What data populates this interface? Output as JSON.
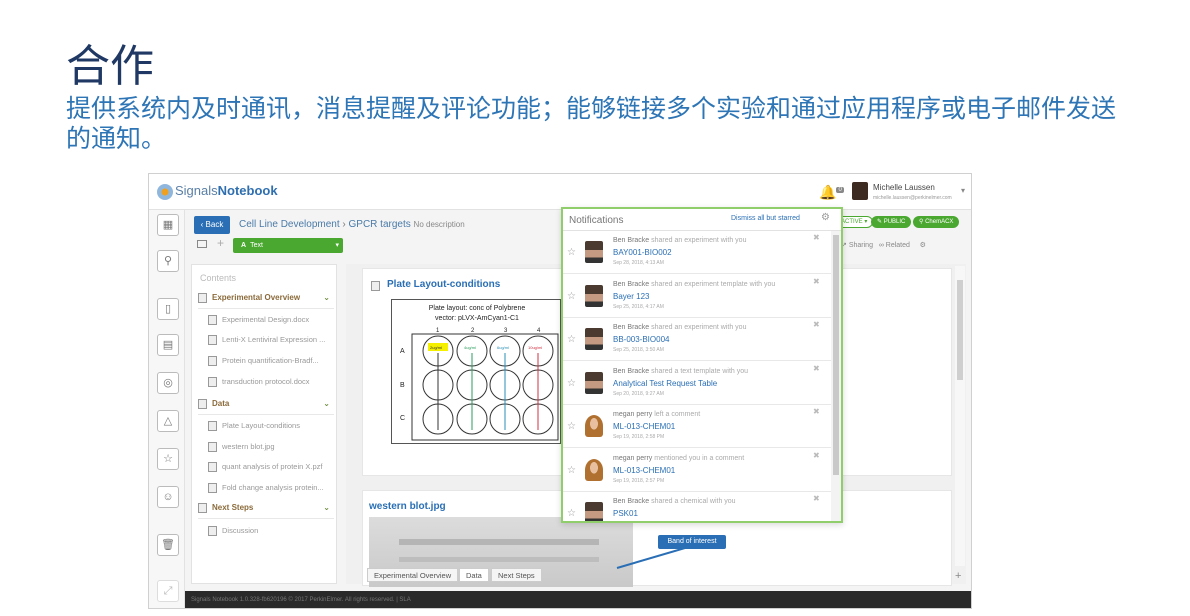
{
  "slide": {
    "title": "合作",
    "subtitle": "提供系统内及时通讯，消息提醒及评论功能；能够链接多个实验和通过应用程序或电子邮件发送的通知。"
  },
  "app": {
    "logo_prefix": "Signals",
    "logo_suffix": "Notebook",
    "bell_count": "0",
    "user_name": "Michelle Laussen",
    "user_email": "michelle.laussen@perkinelmer.com",
    "back_label": "Back",
    "breadcrumb_parent": "Cell Line Development",
    "breadcrumb_current": "GPCR targets",
    "breadcrumb_desc": "No description",
    "text_button": "Text",
    "status_pill": "ACTIVE",
    "public_pill": "PUBLIC",
    "chem_pill": "ChemACX",
    "sharing_label": "Sharing",
    "related_label": "Related",
    "footer_text": "Signals Notebook 1.0.328-fb620196 © 2017 PerkinElmer. All rights reserved. | SLA"
  },
  "contents": {
    "title": "Contents",
    "sections": [
      {
        "label": "Experimental Overview",
        "items": [
          "Experimental Design.docx",
          "Lenti-X Lentiviral Expression ...",
          "Protein quantification-Bradf...",
          "transduction protocol.docx"
        ]
      },
      {
        "label": "Data",
        "items": [
          "Plate Layout-conditions",
          "western blot.jpg",
          "quant analysis of protein X.pzf",
          "Fold change analysis protein..."
        ]
      },
      {
        "label": "Next Steps",
        "items": [
          "Discussion"
        ]
      }
    ]
  },
  "canvas": {
    "card1_title": "Plate Layout-conditions",
    "plate_caption_1": "Plate layout: conc of Polybrene",
    "plate_caption_2": "vector: pLVX-AmCyan1-C1",
    "plate_cols": [
      "1",
      "2",
      "3",
      "4"
    ],
    "plate_rows": [
      "A",
      "B",
      "C"
    ],
    "plate_well_labels": [
      "2ug/ml",
      "4ug/ml",
      "6ug/ml",
      "10ug/ml"
    ],
    "card2_title": "western blot.jpg",
    "band_label": "Band of interest"
  },
  "bottom_tabs": [
    "Experimental Overview",
    "Data",
    "Next Steps"
  ],
  "notifications": {
    "title": "Notifications",
    "dismiss_label": "Dismiss all but starred",
    "items": [
      {
        "who": "Ben Bracke",
        "action": "shared an experiment with you",
        "target": "BAY001-BIO002",
        "date": "Sep 28, 2018, 4:13 AM",
        "avatar": "man"
      },
      {
        "who": "Ben Bracke",
        "action": "shared an experiment template with you",
        "target": "Bayer 123",
        "date": "Sep 25, 2018, 4:17 AM",
        "avatar": "man"
      },
      {
        "who": "Ben Bracke",
        "action": "shared an experiment with you",
        "target": "BB-003-BIO004",
        "date": "Sep 25, 2018, 3:50 AM",
        "avatar": "man"
      },
      {
        "who": "Ben Bracke",
        "action": "shared a text template with you",
        "target": "Analytical Test Request Table",
        "date": "Sep 20, 2018, 9:27 AM",
        "avatar": "man"
      },
      {
        "who": "megan perry",
        "action": "left a comment",
        "target": "ML-013-CHEM01",
        "date": "Sep 19, 2018, 2:58 PM",
        "avatar": "woman"
      },
      {
        "who": "megan perry",
        "action": "mentioned you in a comment",
        "target": "ML-013-CHEM01",
        "date": "Sep 19, 2018, 2:57 PM",
        "avatar": "woman"
      },
      {
        "who": "Ben Bracke",
        "action": "shared a chemical with you",
        "target": "PSK01",
        "date": "",
        "avatar": "man"
      }
    ]
  }
}
